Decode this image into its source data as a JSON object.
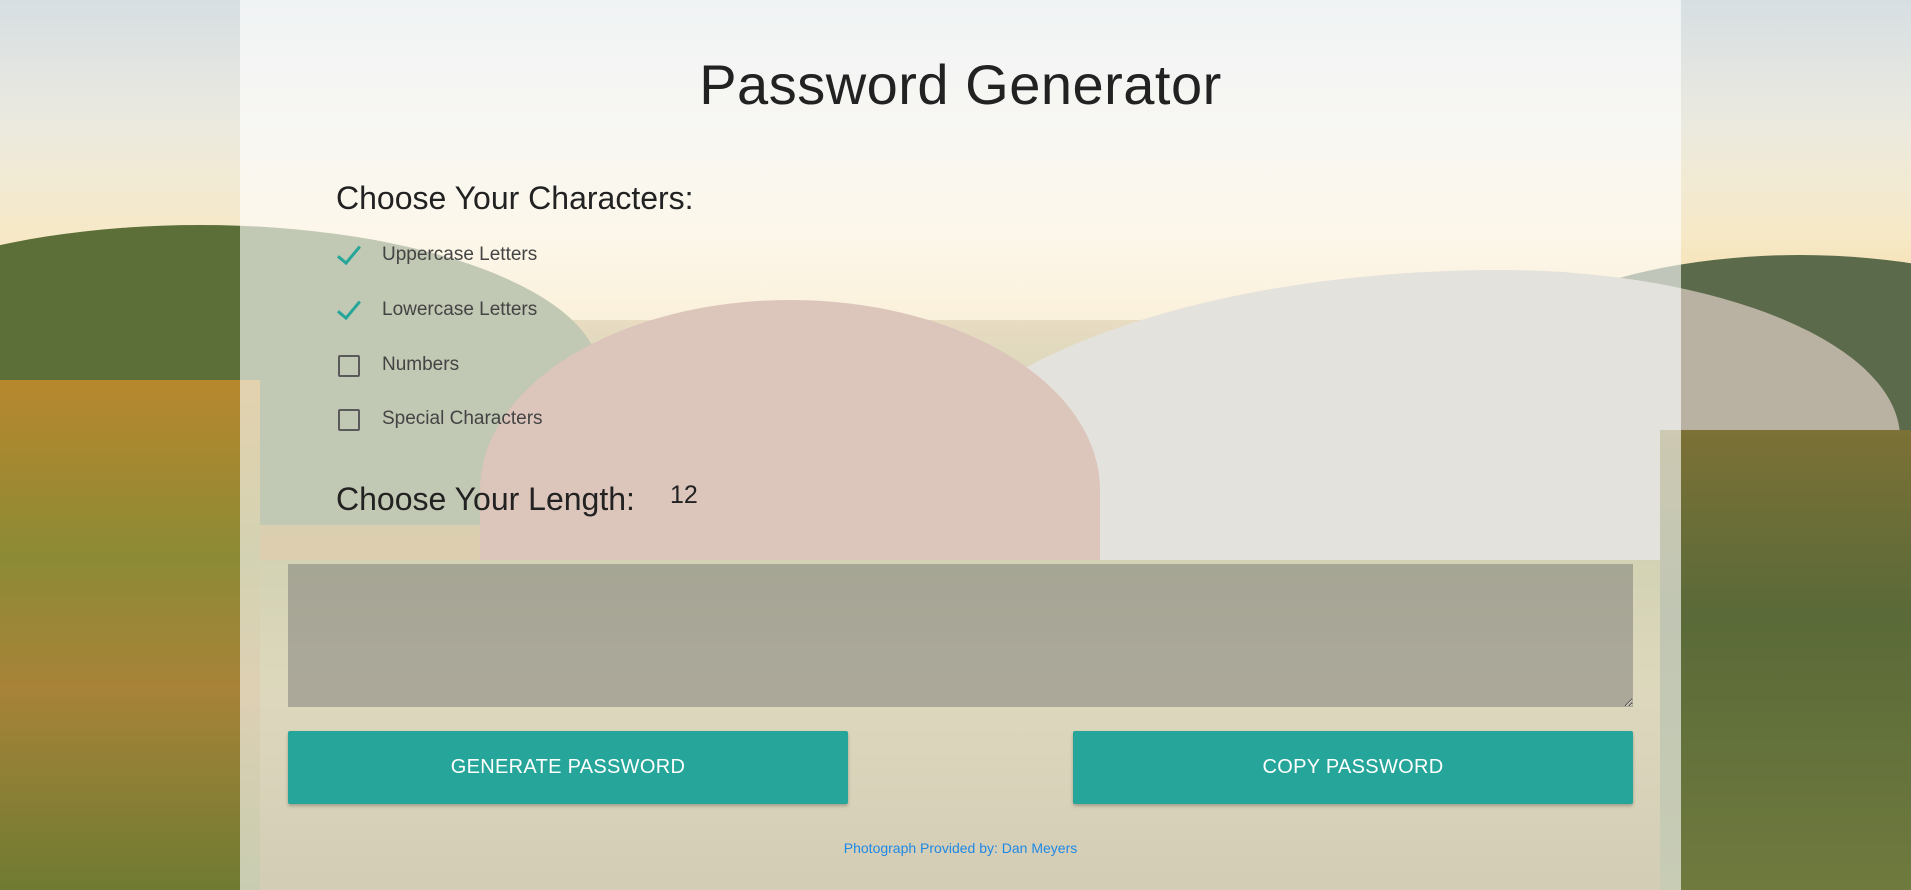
{
  "page": {
    "title": "Password Generator"
  },
  "characters": {
    "heading": "Choose Your Characters:",
    "options": [
      {
        "label": "Uppercase Letters",
        "checked": true
      },
      {
        "label": "Lowercase Letters",
        "checked": true
      },
      {
        "label": "Numbers",
        "checked": false
      },
      {
        "label": "Special Characters",
        "checked": false
      }
    ]
  },
  "length": {
    "heading": "Choose Your Length:",
    "value": "12"
  },
  "output": {
    "value": ""
  },
  "buttons": {
    "generate_label": "GENERATE PASSWORD",
    "copy_label": "COPY PASSWORD"
  },
  "credit": {
    "prefix": "Photograph Provided by:",
    "author": "Dan Meyers"
  },
  "colors": {
    "accent": "#26a69a",
    "link": "#1e88e5"
  }
}
